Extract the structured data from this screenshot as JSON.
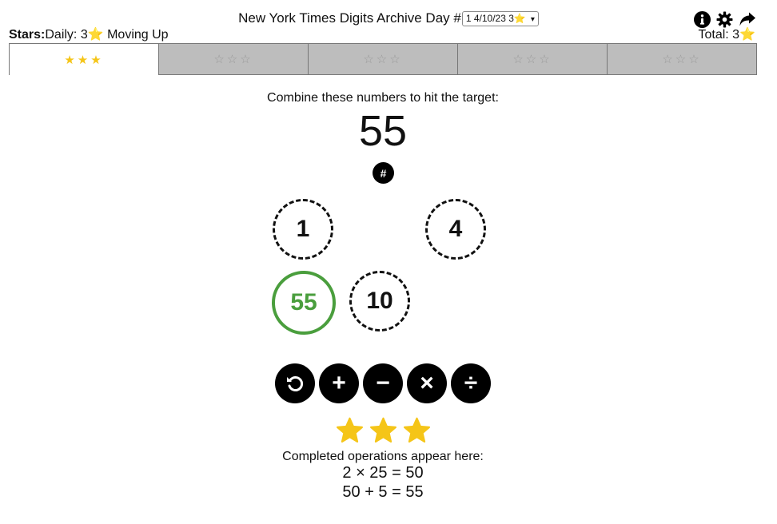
{
  "header": {
    "title": "New York Times Digits Archive Day #",
    "day_select_value": "1 4/10/23 3",
    "day_select_star": "⭐"
  },
  "icons": [
    "info-icon",
    "gear-icon",
    "share-icon",
    "undo-icon"
  ],
  "stars_line": {
    "label": "Stars:",
    "daily_text": "Daily: 3",
    "star": "⭐",
    "status": " Moving Up"
  },
  "total": {
    "text": "Total: 3",
    "star": "⭐"
  },
  "tabs": [
    {
      "stars": "★★★",
      "active": true
    },
    {
      "stars": "☆☆☆",
      "active": false
    },
    {
      "stars": "☆☆☆",
      "active": false
    },
    {
      "stars": "☆☆☆",
      "active": false
    },
    {
      "stars": "☆☆☆",
      "active": false
    }
  ],
  "puzzle": {
    "prompt": "Combine these numbers to hit the target:",
    "target": "55",
    "hash_label": "#",
    "numbers": [
      "1",
      "4",
      "55",
      "10"
    ]
  },
  "operations": {
    "add": "+",
    "subtract": "−",
    "multiply": "×",
    "divide": "÷"
  },
  "results": {
    "stars_earned": 3,
    "completed_label": "Completed operations appear here:",
    "ops": [
      "2 × 25 = 50",
      "50 + 5 = 55"
    ]
  },
  "colors": {
    "star_gold": "#f5c518",
    "solved_green": "#4a9e3d",
    "tab_inactive": "#bdbdbd"
  }
}
